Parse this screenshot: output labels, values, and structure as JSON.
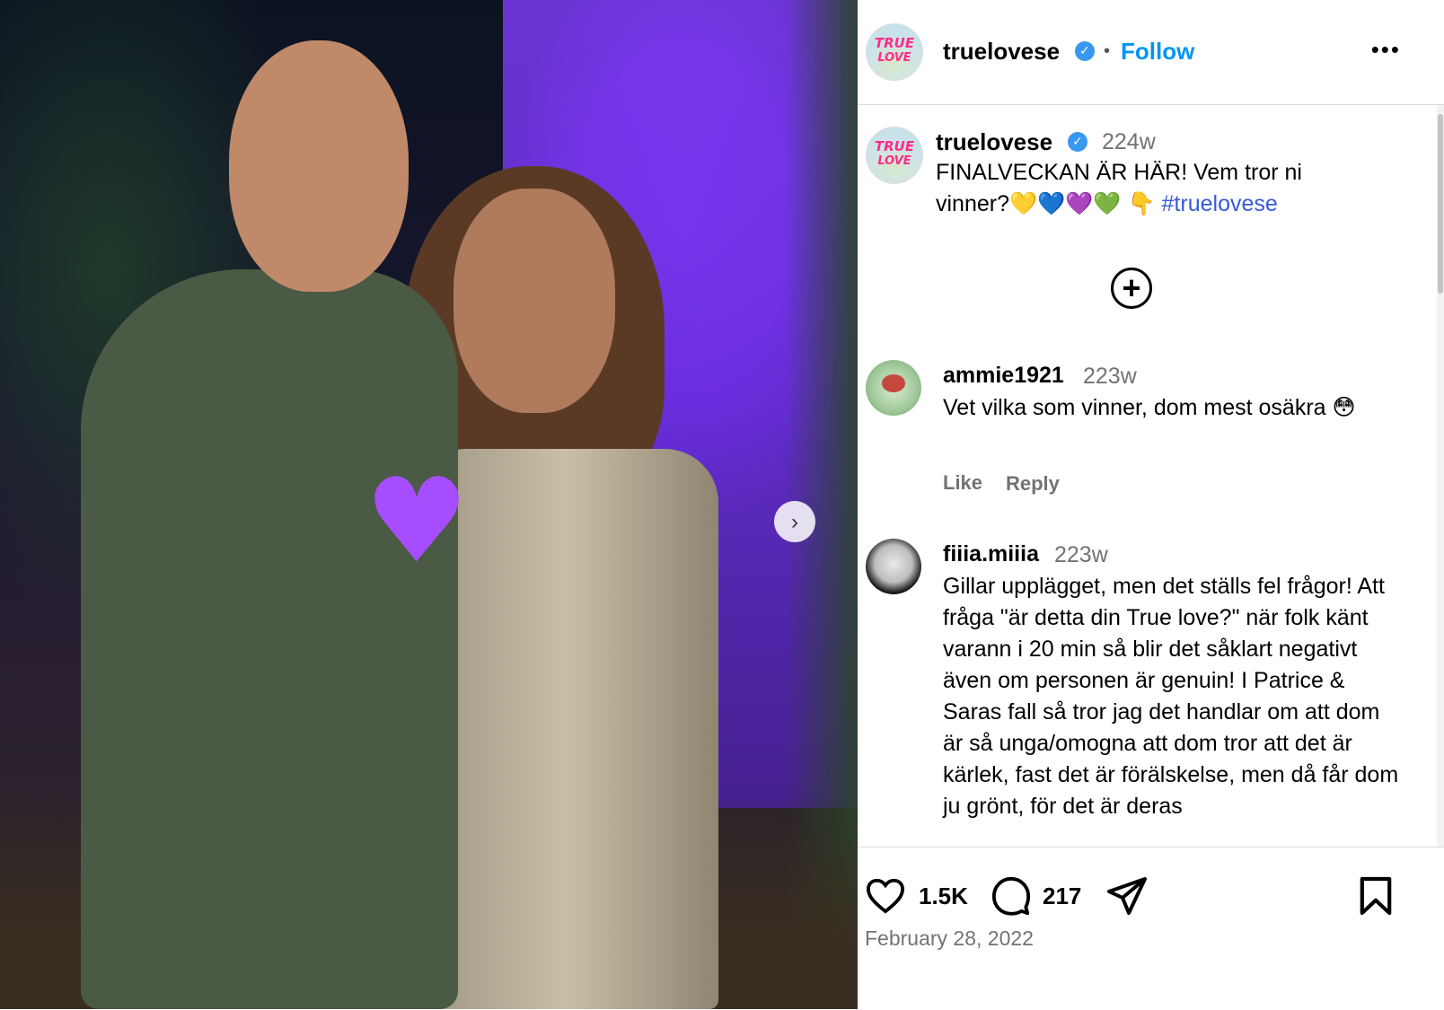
{
  "post": {
    "username": "truelovese",
    "follow_label": "Follow",
    "separator": "•",
    "more_label": "•••",
    "logo_line1": "TRUE",
    "logo_line2": "LOVE",
    "next_label": "›",
    "overlay_heart": "♥"
  },
  "caption": {
    "username": "truelovese",
    "time": "224w",
    "text": "FINALVECKAN ÄR HÄR! Vem tror ni vinner?💛💙💜💚 👇 ",
    "hashtag": "#truelovese",
    "load_more_label": "+"
  },
  "comments": [
    {
      "username": "ammie1921",
      "time": "223w",
      "text": "Vet vilka som vinner, dom mest osäkra 😳",
      "like_label": "Like",
      "reply_label": "Reply"
    },
    {
      "username": "fiiia.miiia",
      "time": "223w",
      "text": "Gillar upplägget, men det ställs fel frågor! Att fråga \"är detta din True love?\" när folk känt varann i 20 min så blir det såklart negativt även om personen är genuin! I Patrice & Saras fall så tror jag det handlar om att dom är så unga/omogna att dom tror att det är kärlek, fast det är förälskelse, men då får dom ju grönt, för det är deras"
    }
  ],
  "stats": {
    "likes": "1.5K",
    "comments": "217",
    "date": "February 28, 2022"
  },
  "colors": {
    "link_blue": "#0095f6",
    "hashtag_blue": "#385ad7",
    "verified_blue": "#3897f0",
    "muted": "#737373"
  }
}
